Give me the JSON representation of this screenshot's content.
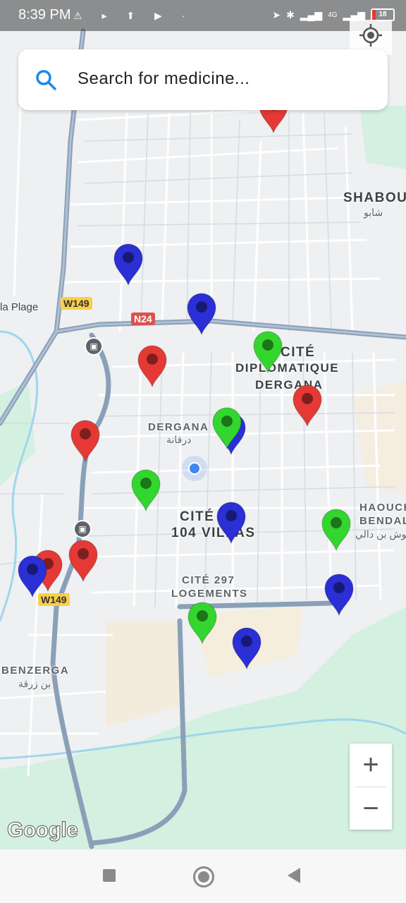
{
  "status": {
    "time": "8:39 PM",
    "left_icons": "⚠ ▸ ⬆ ▶ ·",
    "battery": "18",
    "network": "4G"
  },
  "search": {
    "placeholder": "Search for medicine..."
  },
  "map_labels": {
    "shabou": "SHABOU",
    "shabou_ar": "شابو",
    "la_plage": "la Plage",
    "cite_diplo_1": "CITÉ",
    "cite_diplo_2": "DIPLOMATIQUE",
    "cite_diplo_3": "DERGANA",
    "dergana": "DERGANA",
    "dergana_ar": "درقانة",
    "cite_104_1": "CITÉ",
    "cite_104_2": "104 VILLAS",
    "cite_297_1": "CITÉ 297",
    "cite_297_2": "LOGEMENTS",
    "haouch_1": "HAOUCH",
    "haouch_2": "BENDAL",
    "haouch_ar": "حوش بن دالي",
    "benzerga": "BENZERGA",
    "benzerga_ar": "بن زرقة",
    "w149_a": "W149",
    "w149_b": "W149",
    "n24": "N24",
    "google": "Google"
  },
  "zoom": {
    "in": "+",
    "out": "−"
  },
  "colors": {
    "red": "#e53935",
    "blue": "#2a2fd6",
    "green": "#33d62f",
    "water": "#9fd6ec",
    "park": "#cdeedd",
    "road": "#8aa0b8"
  },
  "markers": [
    {
      "color": "red"
    },
    {
      "color": "blue"
    },
    {
      "color": "blue"
    },
    {
      "color": "red"
    },
    {
      "color": "green"
    },
    {
      "color": "red"
    },
    {
      "color": "red"
    },
    {
      "color": "green"
    },
    {
      "color": "blue"
    },
    {
      "color": "green"
    },
    {
      "color": "blue"
    },
    {
      "color": "green"
    },
    {
      "color": "red"
    },
    {
      "color": "red"
    },
    {
      "color": "blue"
    },
    {
      "color": "blue"
    },
    {
      "color": "green"
    },
    {
      "color": "blue"
    }
  ]
}
